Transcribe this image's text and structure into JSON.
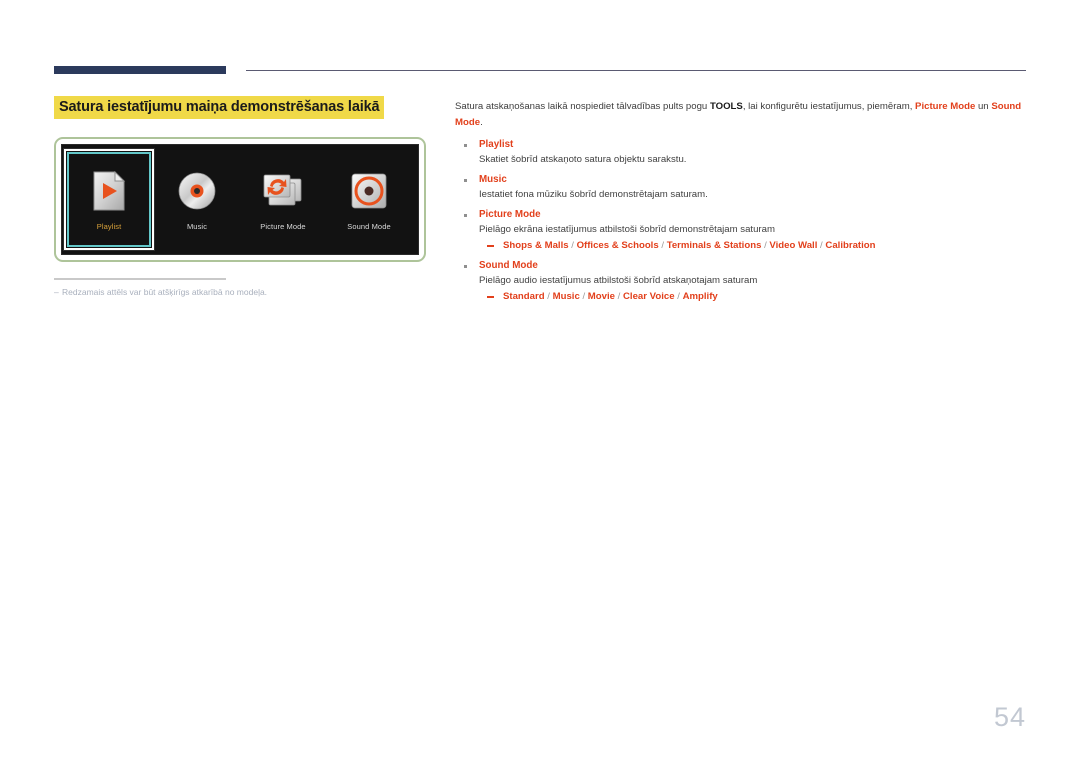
{
  "page": {
    "number": "54",
    "title": "Satura iestatījumu maiņa demonstrēšanas laikā"
  },
  "figure": {
    "caption_dash": "–",
    "caption": "Redzamais attēls var būt atšķirīgs atkarībā no modeļa.",
    "tiles": [
      {
        "label": "Playlist",
        "icon": "playlist-file-play-icon",
        "selected": true
      },
      {
        "label": "Music",
        "icon": "music-disc-icon",
        "selected": false
      },
      {
        "label": "Picture Mode",
        "icon": "picture-mode-refresh-icon",
        "selected": false
      },
      {
        "label": "Sound Mode",
        "icon": "sound-mode-speaker-icon",
        "selected": false
      }
    ]
  },
  "body": {
    "intro": {
      "part1": "Satura atskaņošanas laikā nospiediet tālvadības pults pogu ",
      "tools": "TOOLS",
      "part2": ", lai konfigurētu iestatījumus, piemēram, ",
      "picture_mode": "Picture Mode",
      "part3": " un ",
      "sound_mode": "Sound Mode",
      "part4": "."
    },
    "items": [
      {
        "head": "Playlist",
        "desc": "Skatiet šobrīd atskaņoto satura objektu sarakstu.",
        "options": []
      },
      {
        "head": "Music",
        "desc": "Iestatiet fona mūziku šobrīd demonstrētajam saturam.",
        "options": []
      },
      {
        "head": "Picture Mode",
        "desc": "Pielāgo ekrāna iestatījumus atbilstoši šobrīd demonstrētajam saturam",
        "options": [
          "Shops & Malls",
          "Offices & Schools",
          "Terminals & Stations",
          "Video Wall",
          "Calibration"
        ]
      },
      {
        "head": "Sound Mode",
        "desc": "Pielāgo audio iestatījumus atbilstoši šobrīd atskaņotajam saturam",
        "options": [
          "Standard",
          "Music",
          "Movie",
          "Clear Voice",
          "Amplify"
        ]
      }
    ]
  },
  "colors": {
    "accent_red": "#e2401c",
    "highlight_yellow": "#f0d948",
    "header_navy": "#2b3a5c",
    "frame_green": "#aec49a",
    "selection_cyan": "#63c7c9",
    "page_number_gray": "#c2c8d2"
  }
}
